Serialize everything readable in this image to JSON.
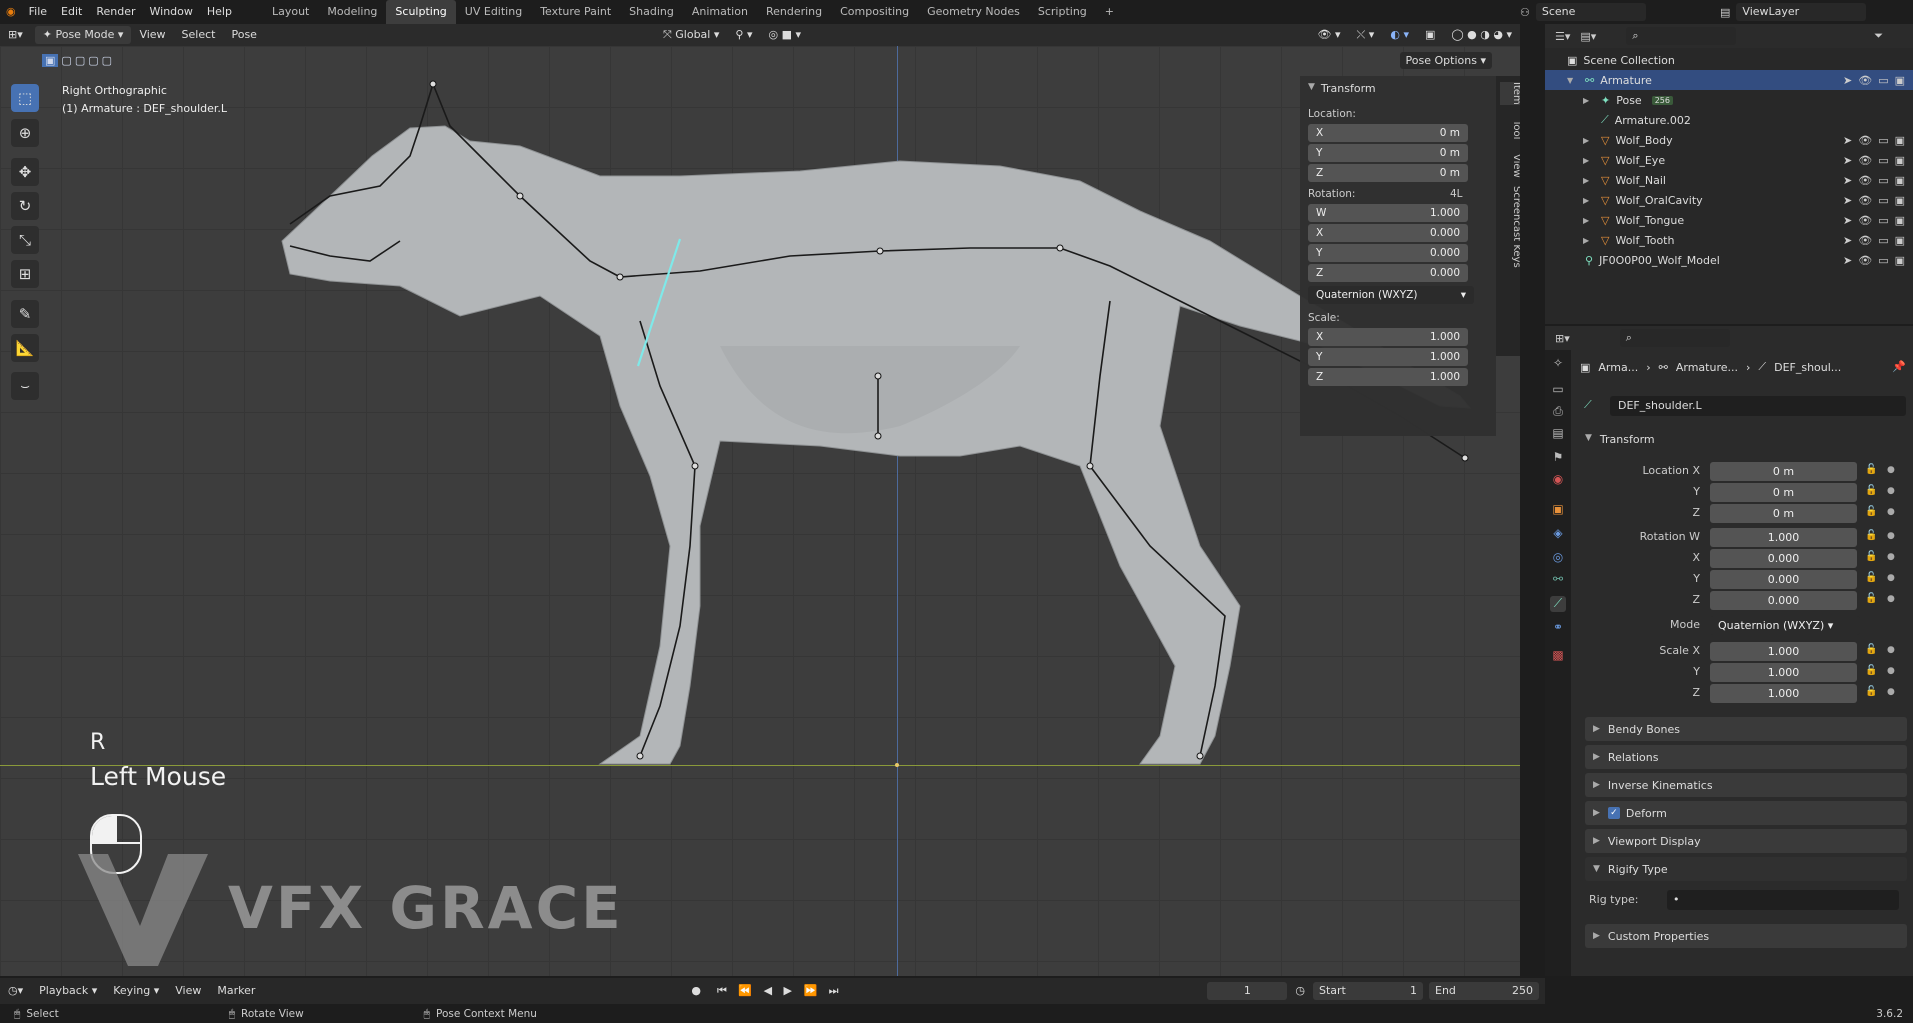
{
  "topbar": {
    "menus": [
      "File",
      "Edit",
      "Render",
      "Window",
      "Help"
    ],
    "workspaces": [
      "Layout",
      "Modeling",
      "Sculpting",
      "UV Editing",
      "Texture Paint",
      "Shading",
      "Animation",
      "Rendering",
      "Compositing",
      "Geometry Nodes",
      "Scripting"
    ],
    "active_workspace": "Sculpting",
    "add_tab": "+",
    "scene": "Scene",
    "view_layer": "ViewLayer"
  },
  "viewport_header": {
    "mode": "Pose Mode",
    "menus": [
      "View",
      "Select",
      "Pose"
    ],
    "orientation": "Global",
    "pose_options": "Pose Options"
  },
  "viewport": {
    "view_name": "Right Orthographic",
    "active_object": "(1) Armature : DEF_shoulder.L",
    "key_overlay": "R",
    "mouse_overlay": "Left Mouse",
    "watermark": "VFX GRACE"
  },
  "npanel": {
    "title": "Transform",
    "location_label": "Location:",
    "location": [
      [
        "X",
        "0 m"
      ],
      [
        "Y",
        "0 m"
      ],
      [
        "Z",
        "0 m"
      ]
    ],
    "rotation_label": "Rotation:",
    "rotation_mode_short": "4L",
    "rotation": [
      [
        "W",
        "1.000"
      ],
      [
        "X",
        "0.000"
      ],
      [
        "Y",
        "0.000"
      ],
      [
        "Z",
        "0.000"
      ]
    ],
    "rotation_mode": "Quaternion (WXYZ)",
    "scale_label": "Scale:",
    "scale": [
      [
        "X",
        "1.000"
      ],
      [
        "Y",
        "1.000"
      ],
      [
        "Z",
        "1.000"
      ]
    ],
    "tabs": [
      "Item",
      "Tool",
      "View",
      "Screencast Keys"
    ]
  },
  "outliner": {
    "root": "Scene Collection",
    "rows": [
      {
        "name": "Armature",
        "indent": 1,
        "selected": true
      },
      {
        "name": "Pose",
        "indent": 2,
        "badge": "256"
      },
      {
        "name": "Armature.002",
        "indent": 2
      },
      {
        "name": "Wolf_Body",
        "indent": 2
      },
      {
        "name": "Wolf_Eye",
        "indent": 2
      },
      {
        "name": "Wolf_Nail",
        "indent": 2
      },
      {
        "name": "Wolf_OralCavity",
        "indent": 2
      },
      {
        "name": "Wolf_Tongue",
        "indent": 2
      },
      {
        "name": "Wolf_Tooth",
        "indent": 2
      },
      {
        "name": "JF0O0P00_Wolf_Model",
        "indent": 1
      }
    ]
  },
  "properties": {
    "breadcrumb": [
      "Arma...",
      "Armature...",
      "DEF_shoul..."
    ],
    "bone_name": "DEF_shoulder.L",
    "transform_title": "Transform",
    "location_labels": [
      "Location X",
      "Y",
      "Z"
    ],
    "location_values": [
      "0 m",
      "0 m",
      "0 m"
    ],
    "rotation_labels": [
      "Rotation W",
      "X",
      "Y",
      "Z"
    ],
    "rotation_values": [
      "1.000",
      "0.000",
      "0.000",
      "0.000"
    ],
    "mode_label": "Mode",
    "mode_value": "Quaternion (WXYZ)",
    "scale_labels": [
      "Scale X",
      "Y",
      "Z"
    ],
    "scale_values": [
      "1.000",
      "1.000",
      "1.000"
    ],
    "sections": [
      "Bendy Bones",
      "Relations",
      "Inverse Kinematics",
      "Deform",
      "Viewport Display",
      "Rigify Type"
    ],
    "rig_type_label": "Rig type:",
    "custom_props": "Custom Properties"
  },
  "timeline": {
    "menus": [
      "Playback",
      "Keying",
      "View",
      "Marker"
    ],
    "current_frame": "1",
    "start_label": "Start",
    "start": "1",
    "end_label": "End",
    "end": "250"
  },
  "statusbar": {
    "items": [
      "Select",
      "Rotate View",
      "Pose Context Menu"
    ],
    "version": "3.6.2"
  },
  "colors": {
    "accent": "#4772b3",
    "active_bone": "#7fe9e9",
    "floor_line": "#8a9a3a"
  }
}
